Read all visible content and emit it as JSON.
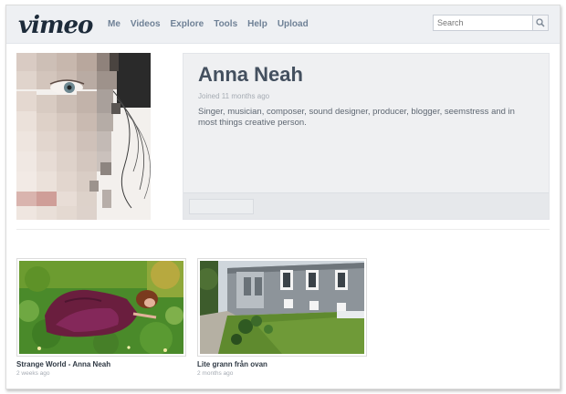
{
  "app": {
    "logo": "vimeo"
  },
  "nav": {
    "items": [
      "Me",
      "Videos",
      "Explore",
      "Tools",
      "Help",
      "Upload"
    ]
  },
  "search": {
    "placeholder": "Search"
  },
  "profile": {
    "name": "Anna Neah",
    "joined": "Joined 11 months ago",
    "bio": "Singer, musician, composer, sound designer, producer, blogger, seemstress and in most things creative person."
  },
  "videos": [
    {
      "title": "Strange World - Anna Neah",
      "age": "2 weeks ago"
    },
    {
      "title": "Lite grann från ovan",
      "age": "2 months ago"
    }
  ],
  "icons": {
    "search": "search-icon"
  },
  "colors": {
    "nav_text": "#6f8196",
    "topbar_bg": "#eef0f3",
    "name_text": "#44505f"
  }
}
